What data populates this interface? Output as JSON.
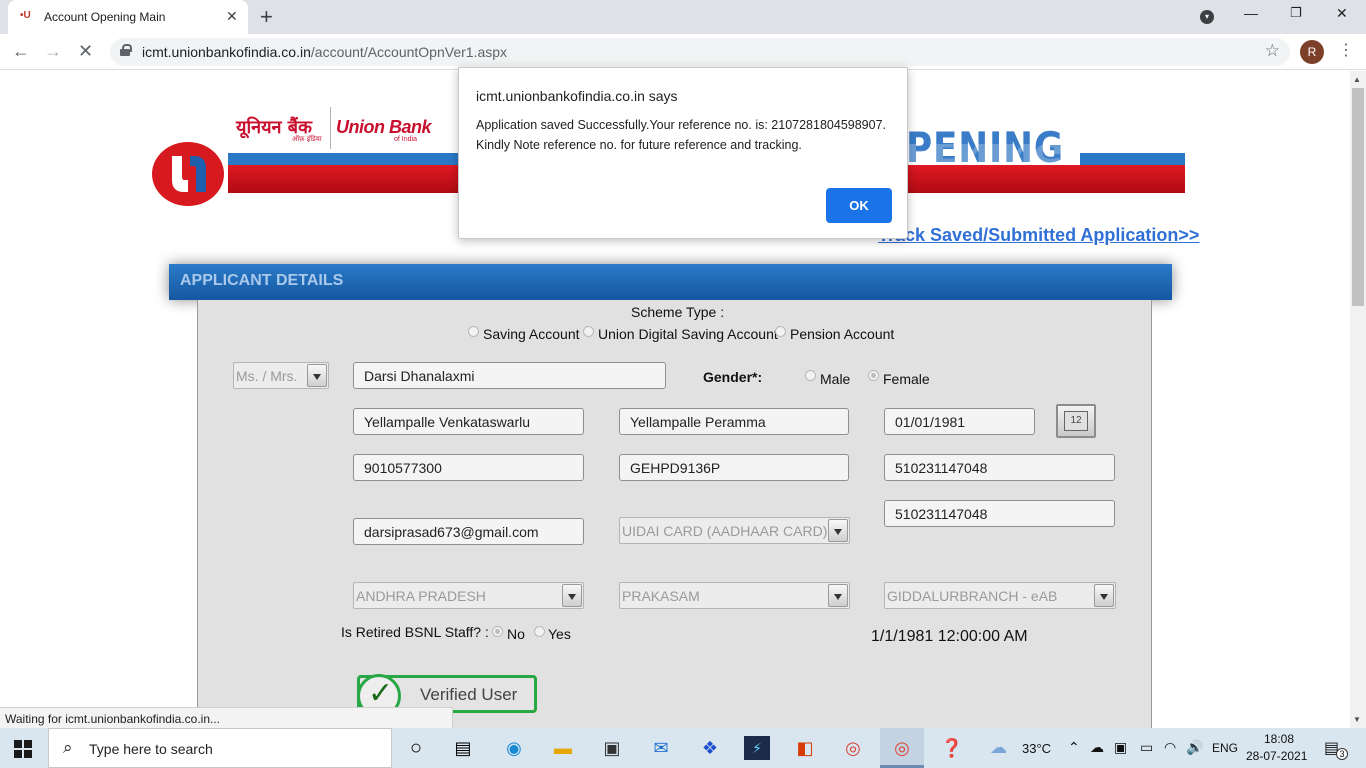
{
  "browser": {
    "tab_title": "Account Opening Main",
    "tab_favicon": "union-bank-logo",
    "url_host": "icmt.unionbankofindia.co.in",
    "url_path": "/account/AccountOpnVer1.aspx",
    "profile_initial": "R",
    "status_text": "Waiting for icmt.unionbankofindia.co.in..."
  },
  "header": {
    "bank_name_hindi": "यूनियन बैंक",
    "bank_tag_hindi": "ऑफ़ इंडिया",
    "bank_name": "Union Bank",
    "bank_name_sub": "of India",
    "banner_text": "PENING",
    "track_link": "Track Saved/Submitted Application>>"
  },
  "section": {
    "title": "APPLICANT DETAILS"
  },
  "form": {
    "scheme_label": "Scheme Type :",
    "scheme_options": [
      "Saving Account",
      "Union Digital Saving Account",
      "Pension Account"
    ],
    "salutation": "Ms. / Mrs.",
    "name": "Darsi Dhanalaxmi",
    "gender_label": "Gender*:",
    "gender_options": [
      "Male",
      "Female"
    ],
    "gender_selected": "Female",
    "father_name": "Yellampalle Venkataswarlu",
    "mother_name": "Yellampalle Peramma",
    "dob": "01/01/1981",
    "mobile": "9010577300",
    "pan": "GEHPD9136P",
    "aadhaar_1": "510231147048",
    "aadhaar_2": "510231147048",
    "email": "darsiprasad673@gmail.com",
    "id_type": "UIDAI CARD (AADHAAR CARD)",
    "state": "ANDHRA PRADESH",
    "district": "PRAKASAM",
    "branch": "GIDDALURBRANCH - eAB",
    "bsnl_label": "Is Retired BSNL Staff? :",
    "bsnl_options": [
      "No",
      "Yes"
    ],
    "bsnl_selected": "No",
    "dob_display": "1/1/1981 12:00:00 AM",
    "verified_label": "Verified User"
  },
  "dialog": {
    "origin": "icmt.unionbankofindia.co.in says",
    "message": "Application saved Successfully.Your reference no. is: 2107281804598907. Kindly Note reference no. for future reference and tracking.",
    "ok_label": "OK"
  },
  "taskbar": {
    "search_placeholder": "Type here to search",
    "weather_temp": "33°C",
    "language": "ENG",
    "time": "18:08",
    "date": "28-07-2021",
    "notification_count": "3"
  }
}
